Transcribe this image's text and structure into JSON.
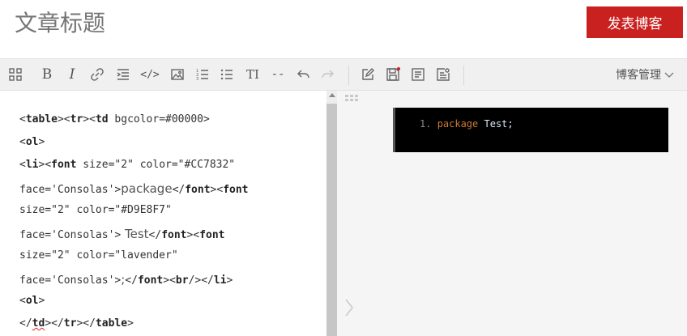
{
  "header": {
    "title_placeholder": "文章标题",
    "publish_label": "发表博客"
  },
  "toolbar": {
    "buttons": [
      {
        "name": "apps-grid-icon"
      },
      {
        "name": "bold-icon",
        "text": "B"
      },
      {
        "name": "italic-icon",
        "text": "I"
      },
      {
        "name": "link-icon"
      },
      {
        "name": "indent-icon"
      },
      {
        "name": "code-icon",
        "text": "</>"
      },
      {
        "name": "image-icon"
      },
      {
        "name": "ordered-list-icon"
      },
      {
        "name": "unordered-list-icon"
      },
      {
        "name": "heading-icon",
        "text": "TI"
      },
      {
        "name": "horizontal-rule-icon",
        "text": "--"
      },
      {
        "name": "undo-icon"
      },
      {
        "name": "redo-icon"
      },
      {
        "name": "edit-icon"
      },
      {
        "name": "save-icon"
      },
      {
        "name": "summary-icon"
      },
      {
        "name": "settings-doc-icon"
      }
    ],
    "blog_management_label": "博客管理"
  },
  "editor": {
    "lines": [
      {
        "parts": [
          [
            "<"
          ],
          [
            "table",
            "b"
          ],
          [
            ">"
          ],
          [
            "<"
          ],
          [
            "tr",
            "b"
          ],
          [
            ">"
          ],
          [
            "<"
          ],
          [
            "td",
            "b"
          ],
          [
            " bgcolor=#00000>"
          ]
        ]
      },
      {
        "parts": [
          [
            "<"
          ],
          [
            "ol",
            "b"
          ],
          [
            ">"
          ]
        ]
      },
      {
        "parts": [
          [
            "<"
          ],
          [
            "li",
            "b"
          ],
          [
            ">"
          ],
          [
            "<"
          ],
          [
            "font",
            "b"
          ],
          [
            " size=\"2\" color=\"#CC7832\""
          ]
        ]
      },
      {
        "parts": [
          [
            "face='Consolas'>"
          ],
          [
            "package",
            "p"
          ],
          [
            "</"
          ],
          [
            "font",
            "b"
          ],
          [
            ">"
          ],
          [
            "<"
          ],
          [
            "font",
            "b"
          ]
        ]
      },
      {
        "parts": [
          [
            "size=\"2\" color=\"#D9E8F7\""
          ]
        ]
      },
      {
        "parts": [
          [
            "face='Consolas'>"
          ],
          [
            " Test",
            "p"
          ],
          [
            "</"
          ],
          [
            "font",
            "b"
          ],
          [
            ">"
          ],
          [
            "<"
          ],
          [
            "font",
            "b"
          ]
        ]
      },
      {
        "parts": [
          [
            "size=\"2\" color=\"lavender\""
          ]
        ]
      },
      {
        "parts": [
          [
            "face='Consolas'>"
          ],
          [
            ";",
            "p"
          ],
          [
            "</"
          ],
          [
            "font",
            "b"
          ],
          [
            ">"
          ],
          [
            "<"
          ],
          [
            "br",
            "b"
          ],
          [
            "/>"
          ],
          [
            "</"
          ],
          [
            "li",
            "b"
          ],
          [
            ">"
          ]
        ]
      },
      {
        "parts": [
          [
            "<"
          ],
          [
            "ol",
            "b"
          ],
          [
            ">"
          ]
        ]
      },
      {
        "parts": [
          [
            "</"
          ],
          [
            "td",
            "bs"
          ],
          [
            ">"
          ],
          [
            "</"
          ],
          [
            "tr",
            "b"
          ],
          [
            ">"
          ],
          [
            "</"
          ],
          [
            "table",
            "b"
          ],
          [
            ">"
          ]
        ]
      }
    ]
  },
  "preview": {
    "line_number": "1.",
    "keyword": "package",
    "identifier": " Test",
    "punct": ";",
    "colors": {
      "keyword": "#CC7832",
      "identifier": "#D9E8F7",
      "punct": "lavender",
      "background": "#000000"
    }
  },
  "colors": {
    "accent": "#c9211f",
    "toolbar_bg": "#f0f0f0",
    "preview_bg": "#f5f5f5"
  }
}
